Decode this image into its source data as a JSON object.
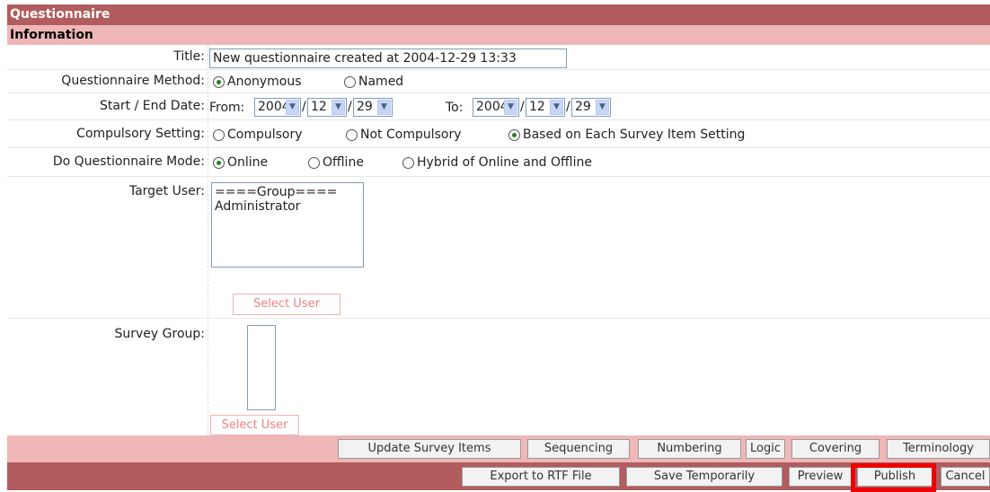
{
  "header": {
    "title": "Questionnaire"
  },
  "section": {
    "title": "Information"
  },
  "form": {
    "title_label": "Title:",
    "title_value": "New questionnaire created at 2004-12-29 13:33",
    "method_label": "Questionnaire Method:",
    "method_options": [
      "Anonymous",
      "Named"
    ],
    "method_selected": "Anonymous",
    "date_label": "Start / End Date:",
    "from_label": "From:",
    "to_label": "To:",
    "slash": "/",
    "start": {
      "year": "2004",
      "month": "12",
      "day": "29"
    },
    "end": {
      "year": "2004",
      "month": "12",
      "day": "29"
    },
    "compulsory_label": "Compulsory Setting:",
    "compulsory_options": [
      "Compulsory",
      "Not Compulsory",
      "Based on Each Survey Item Setting"
    ],
    "compulsory_selected": "Based on Each Survey Item Setting",
    "mode_label": "Do Questionnaire Mode:",
    "mode_options": [
      "Online",
      "Offline",
      "Hybrid of Online and Offline"
    ],
    "mode_selected": "Online",
    "target_label": "Target User:",
    "target_items": [
      "====Group====",
      "Administrator"
    ],
    "select_user_label": "Select User",
    "survey_group_label": "Survey Group:",
    "select_user_label_2": "Select User"
  },
  "toolbar1": {
    "buttons": [
      "Update Survey Items",
      "Sequencing",
      "Numbering",
      "Logic",
      "Covering",
      "Terminology"
    ]
  },
  "toolbar2": {
    "buttons": [
      "Export to RTF File",
      "Save Temporarily",
      "Preview",
      "Publish",
      "Cancel"
    ]
  },
  "colors": {
    "header_bg": "#b15c5f",
    "subheader_bg": "#efb7b7",
    "highlight": "#ee0000"
  }
}
